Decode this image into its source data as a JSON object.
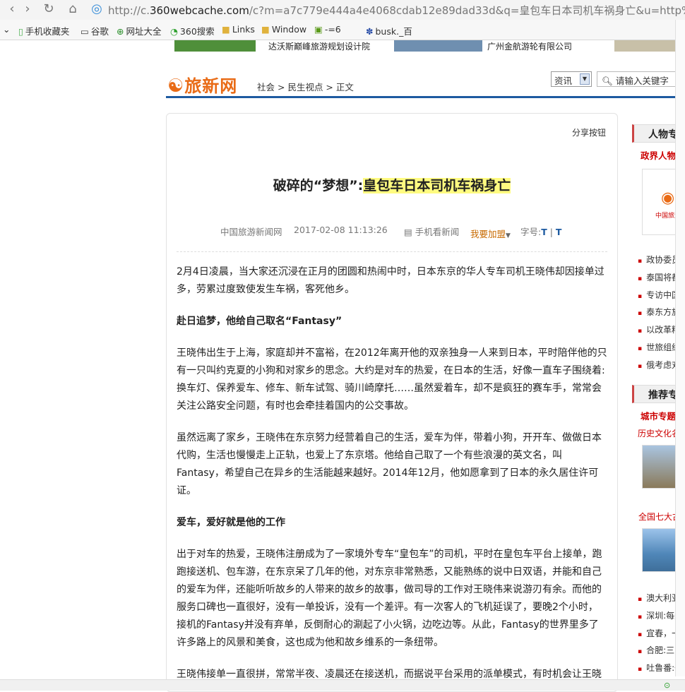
{
  "browser": {
    "url_prefix": "http://c.",
    "url_host": "360webcache.com",
    "url_rest": "/c?m=a7c779e444a4e4068cdab12e89dad33d&q=皇包车日本司机车祸身亡&u=http%",
    "favorites": [
      "手机收藏夹",
      "谷歌",
      "网址大全",
      "360搜索",
      "Links",
      "Window",
      "-=6",
      "busk._百"
    ]
  },
  "banner": {
    "left_text": "达沃斯巅峰旅游规划设计院",
    "right_text": "广州金航游轮有限公司"
  },
  "site": {
    "logo": "旅新网",
    "breadcrumb": [
      "社会",
      "民生视点",
      "正文"
    ],
    "channel_select": "资讯",
    "search_placeholder": "请输入关键字"
  },
  "article": {
    "share_label": "分享按钮",
    "title_prefix": "破碎的“梦想”:",
    "title_highlight": "皇包车日本司机车祸身亡",
    "meta": {
      "source": "中国旅游新闻网",
      "datetime": "2017-02-08 11:13:26",
      "mobile": "手机看新闻",
      "join": "我要加盟",
      "fontsize_label": "字号:",
      "fontsize_large": "T",
      "fontsize_small": "T"
    },
    "paragraphs": [
      "2月4日凌晨，当大家还沉浸在正月的团圆和热闹中时，日本东京的华人专车司机王晓伟却因接单过多，劳累过度致使发生车祸，客死他乡。",
      "赴日追梦，他给自己取名“Fantasy”",
      "王晓伟出生于上海，家庭却并不富裕，在2012年离开他的双亲独身一人来到日本，平时陪伴他的只有一只叫约克夏的小狗和对家乡的思念。大约是对车的热爱，在日本的生活，好像一直车子围绕着:换车灯、保养爱车、修车、新车试驾、骑川崎摩托……虽然爱着车，却不是疯狂的赛车手，常常会关注公路安全问题，有时也会牵挂着国内的公交事故。",
      "虽然远离了家乡，王晓伟在东京努力经营着自己的生活，爱车为伴，带着小狗，开开车、做做日本代购，生活也慢慢走上正轨，也爱上了东京塔。他给自己取了一个有些浪漫的英文名，叫Fantasy，希望自己在异乡的生活能越来越好。2014年12月，他如愿拿到了日本的永久居住许可证。",
      "爱车，爱好就是他的工作",
      "出于对车的热爱，王晓伟注册成为了一家境外专车“皇包车”的司机，平时在皇包车平台上接单，跑跑接送机、包车游，在东京呆了几年的他，对东京非常熟悉，又能熟练的说中日双语，并能和自己的爱车为伴，还能听听故乡的人带来的故乡的故事，做司导的工作对王晓伟来说游刃有余。而他的服务口碑也一直很好，没有一单投诉，没有一个差评。有一次客人的飞机延误了，要晚2个小时，接机的Fantasy并没有弃单，反倒耐心的涮起了小火锅，边吃边等。从此，Fantasy的世界里多了许多路上的风景和美食，这也成为他和故乡维系的一条纽带。",
      "王晓伟接单一直很拼，常常半夜、凌晨还在接送机，而据说平台采用的派单模式，有时机会让王晓"
    ]
  },
  "sidebar": {
    "people_heading": "人物专",
    "people_sub": "政界人物",
    "logo_text": "中国旅游",
    "people_items": [
      "政协委员",
      "泰国将都",
      "专访中国",
      "泰东方旅",
      "以改革精",
      "世旅组织",
      "俄考虑对"
    ],
    "recommend_heading": "推荐专",
    "city_sub": "城市专题",
    "culture_link": "历史文化名",
    "ancient_link": "全国七大古都",
    "recommend_items": [
      "澳大利亚:",
      "深圳:每天",
      "宜春，一座",
      "合肥:三国",
      "吐鲁番:一"
    ]
  }
}
